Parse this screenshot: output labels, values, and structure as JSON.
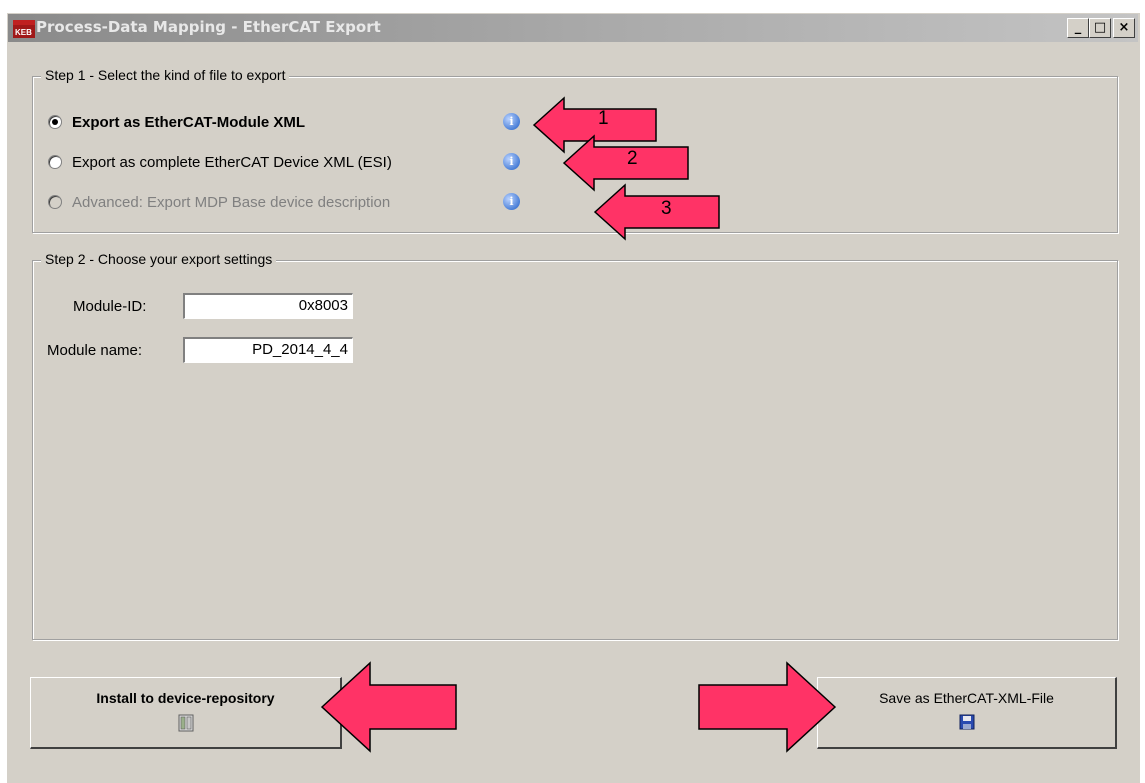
{
  "window": {
    "title": "Process-Data Mapping - EtherCAT Export",
    "controls": {
      "minimize": "_",
      "maximize": "□",
      "close": "×"
    }
  },
  "step1": {
    "label": "Step 1 - Select the kind of file to export",
    "options": [
      {
        "label": "Export as EtherCAT-Module XML",
        "selected": true,
        "enabled": true,
        "info_icon": "info-icon"
      },
      {
        "label": "Export as complete EtherCAT Device XML (ESI)",
        "selected": false,
        "enabled": true,
        "info_icon": "info-icon"
      },
      {
        "label": "Advanced: Export MDP Base device description",
        "selected": false,
        "enabled": false,
        "info_icon": "info-icon"
      }
    ]
  },
  "step2": {
    "label": "Step 2 - Choose your export settings",
    "module_id_label": "Module-ID:",
    "module_id_value": "0x8003",
    "module_name_label": "Module name:",
    "module_name_value": "PD_2014_4_4"
  },
  "buttons": {
    "install": {
      "label": "Install to device-repository",
      "icon": "repository-icon"
    },
    "save": {
      "label": "Save as EtherCAT-XML-File",
      "icon": "floppy-disk-icon"
    }
  },
  "annotations": {
    "arrow_labels": [
      "1",
      "2",
      "3"
    ],
    "arrow_color": "#ff3366"
  }
}
